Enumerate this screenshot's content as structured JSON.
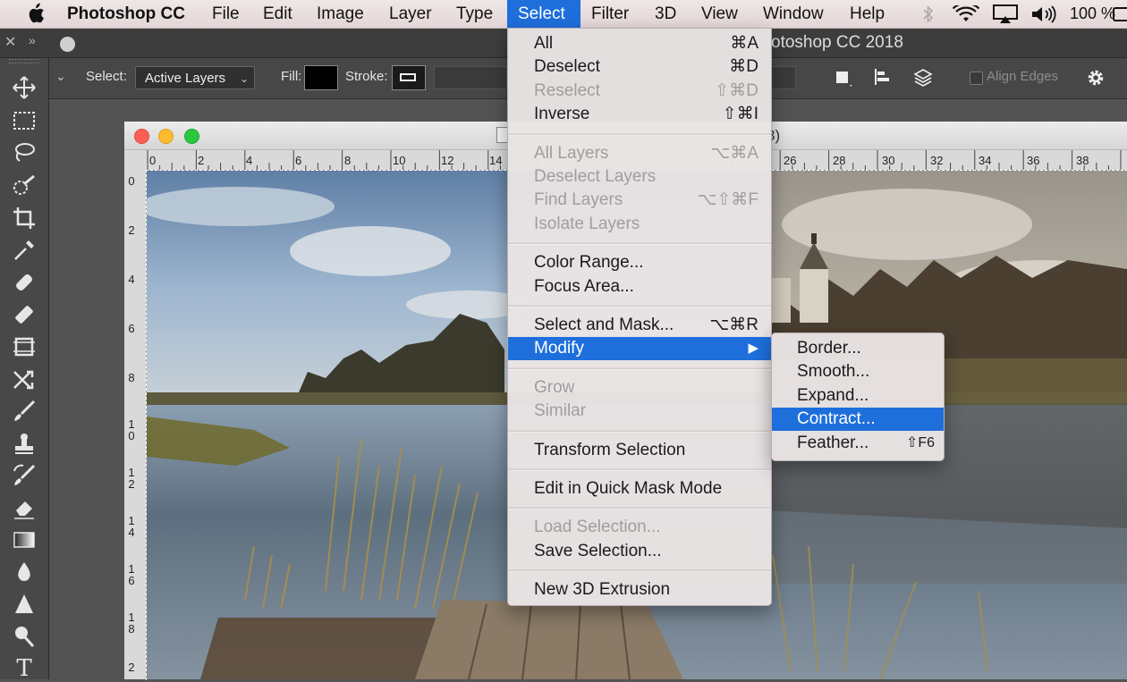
{
  "menubar": {
    "app_name": "Photoshop CC",
    "items": [
      "File",
      "Edit",
      "Image",
      "Layer",
      "Type",
      "Select",
      "Filter",
      "3D",
      "View",
      "Window",
      "Help"
    ],
    "open_item": "Select",
    "battery_text": "100 %"
  },
  "app": {
    "window_title": "otoshop CC 2018"
  },
  "options_bar": {
    "select_label": "Select:",
    "select_value": "Active Layers",
    "fill_label": "Fill:",
    "stroke_label": "Stroke:",
    "align_edges_label": "Align Edges"
  },
  "document": {
    "title_fragment": "8)",
    "ruler_top": [
      "0",
      "2",
      "4",
      "6",
      "8",
      "10",
      "12",
      "14",
      "26",
      "28",
      "30",
      "32",
      "34",
      "36",
      "38"
    ],
    "ruler_left": [
      "0",
      "2",
      "4",
      "6",
      "8",
      "1\n0",
      "1\n2",
      "1\n4",
      "1\n6",
      "1\n8",
      "2"
    ]
  },
  "select_menu": {
    "groups": [
      [
        {
          "label": "All",
          "shortcut": "⌘A",
          "enabled": true
        },
        {
          "label": "Deselect",
          "shortcut": "⌘D",
          "enabled": true
        },
        {
          "label": "Reselect",
          "shortcut": "⇧⌘D",
          "enabled": false
        },
        {
          "label": "Inverse",
          "shortcut": "⇧⌘I",
          "enabled": true
        }
      ],
      [
        {
          "label": "All Layers",
          "shortcut": "⌥⌘A",
          "enabled": false
        },
        {
          "label": "Deselect Layers",
          "shortcut": "",
          "enabled": false
        },
        {
          "label": "Find Layers",
          "shortcut": "⌥⇧⌘F",
          "enabled": false
        },
        {
          "label": "Isolate Layers",
          "shortcut": "",
          "enabled": false
        }
      ],
      [
        {
          "label": "Color Range...",
          "shortcut": "",
          "enabled": true
        },
        {
          "label": "Focus Area...",
          "shortcut": "",
          "enabled": true
        }
      ],
      [
        {
          "label": "Select and Mask...",
          "shortcut": "⌥⌘R",
          "enabled": true
        },
        {
          "label": "Modify",
          "shortcut": "▶",
          "enabled": true,
          "highlighted": true
        }
      ],
      [
        {
          "label": "Grow",
          "shortcut": "",
          "enabled": false
        },
        {
          "label": "Similar",
          "shortcut": "",
          "enabled": false
        }
      ],
      [
        {
          "label": "Transform Selection",
          "shortcut": "",
          "enabled": true
        }
      ],
      [
        {
          "label": "Edit in Quick Mask Mode",
          "shortcut": "",
          "enabled": true
        }
      ],
      [
        {
          "label": "Load Selection...",
          "shortcut": "",
          "enabled": false
        },
        {
          "label": "Save Selection...",
          "shortcut": "",
          "enabled": true
        }
      ],
      [
        {
          "label": "New 3D Extrusion",
          "shortcut": "",
          "enabled": true
        }
      ]
    ]
  },
  "modify_submenu": {
    "items": [
      {
        "label": "Border...",
        "shortcut": "",
        "highlighted": false
      },
      {
        "label": "Smooth...",
        "shortcut": "",
        "highlighted": false
      },
      {
        "label": "Expand...",
        "shortcut": "",
        "highlighted": false
      },
      {
        "label": "Contract...",
        "shortcut": "",
        "highlighted": true
      },
      {
        "label": "Feather...",
        "shortcut": "⇧F6",
        "highlighted": false
      }
    ]
  },
  "colors": {
    "highlight": "#1e6fdc",
    "menu_bg": "#e9e4e4",
    "toolbar_bg": "#484848"
  },
  "toolbar": {
    "tools": [
      "move-tool-icon",
      "marquee-tool-icon",
      "lasso-tool-icon",
      "quick-selection-tool-icon",
      "crop-tool-icon",
      "eyedropper-tool-icon",
      "spot-healing-tool-icon",
      "healing-brush-icon",
      "frame-tool-icon",
      "content-aware-move-icon",
      "brush-tool-icon",
      "clone-stamp-icon",
      "history-brush-icon",
      "eraser-tool-icon",
      "gradient-tool-icon",
      "blur-tool-icon",
      "sharpen-tool-icon",
      "dodge-tool-icon",
      "type-tool-icon"
    ],
    "type_tool_glyph": "T"
  }
}
